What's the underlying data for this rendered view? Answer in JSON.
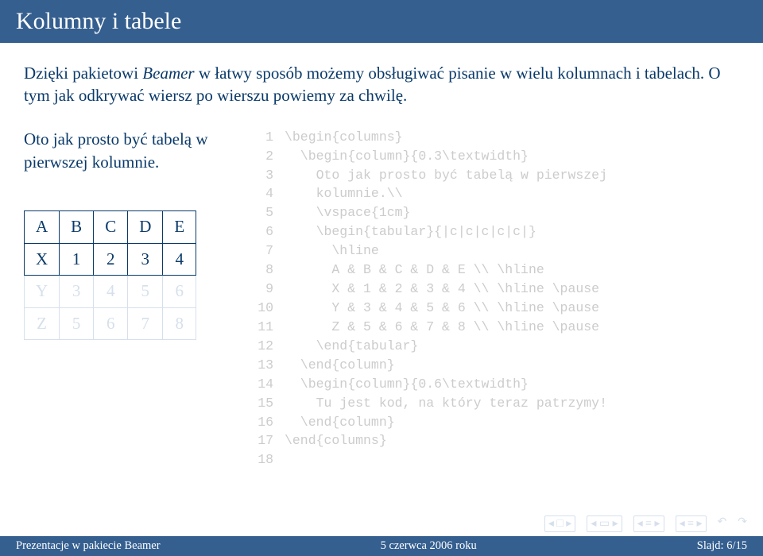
{
  "title": "Kolumny i tabele",
  "intro_part1": "Dzięki pakietowi ",
  "intro_italic": "Beamer",
  "intro_part2": " w łatwy sposób możemy obsługiwać pisanie w wielu kolumnach i tabelach. O tym jak odkrywać wiersz po wierszu powiemy za chwilę.",
  "left_text": "Oto jak prosto być tabelą w pierwszej kolumnie.",
  "table": {
    "rows": [
      [
        "A",
        "B",
        "C",
        "D",
        "E"
      ],
      [
        "X",
        "1",
        "2",
        "3",
        "4"
      ],
      [
        "Y",
        "3",
        "4",
        "5",
        "6"
      ],
      [
        "Z",
        "5",
        "6",
        "7",
        "8"
      ]
    ]
  },
  "code": [
    "\\begin{columns}",
    "  \\begin{column}{0.3\\textwidth}",
    "    Oto jak prosto być tabelą w pierwszej",
    "    kolumnie.\\\\",
    "    \\vspace{1cm}",
    "    \\begin{tabular}{|c|c|c|c|c|}",
    "      \\hline",
    "      A & B & C & D & E \\\\ \\hline",
    "      X & 1 & 2 & 3 & 4 \\\\ \\hline \\pause",
    "      Y & 3 & 4 & 5 & 6 \\\\ \\hline \\pause",
    "      Z & 5 & 6 & 7 & 8 \\\\ \\hline \\pause",
    "    \\end{tabular}",
    "  \\end{column}",
    "  \\begin{column}{0.6\\textwidth}",
    "    Tu jest kod, na który teraz patrzymy!",
    "  \\end{column}",
    "\\end{columns}",
    ""
  ],
  "footer": {
    "left": "Prezentacje w pakiecie Beamer",
    "center": "5 czerwca 2006 roku",
    "right": "Slajd: 6/15"
  }
}
